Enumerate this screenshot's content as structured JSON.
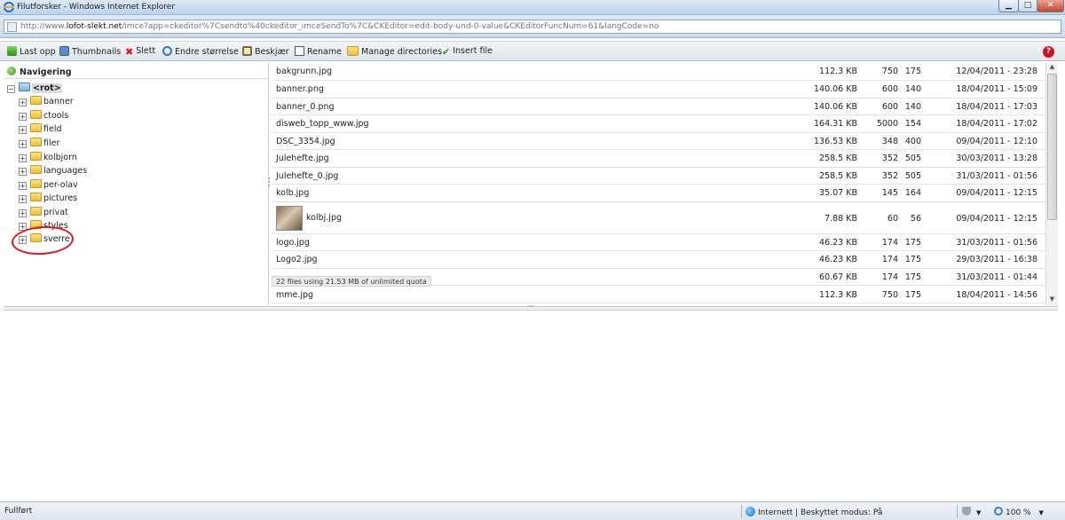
{
  "window": {
    "title": "Filutforsker - Windows Internet Explorer",
    "min_label": "▁",
    "max_label": "□",
    "close_label": "✕",
    "url_prefix": "http://www.",
    "url_host": "lofot-slekt.net",
    "url_rest": "/imce?app=ckeditor%7Csendto%40ckeditor_imceSendTo%7C&CKEditor=edit-body-und-0-value&CKEditorFuncNum=61&langCode=no"
  },
  "toolbar": {
    "upload": "Last opp",
    "thumbnails": "Thumbnails",
    "delete": "Slett",
    "resize": "Endre størrelse",
    "crop": "Beskjær",
    "rename": "Rename",
    "manage": "Manage directories",
    "insert": "Insert file",
    "help": "?"
  },
  "nav": {
    "heading": "Navigering",
    "root": "<rot>",
    "folders": [
      "banner",
      "ctools",
      "field",
      "filer",
      "kolbjorn",
      "languages",
      "per-olav",
      "pictures",
      "privat",
      "styles",
      "sverre"
    ]
  },
  "files": [
    {
      "name": "bakgrunn.jpg",
      "size": "112.3 KB",
      "w": "750",
      "h": "175",
      "date": "12/04/2011 - 23:28"
    },
    {
      "name": "banner.png",
      "size": "140.06 KB",
      "w": "600",
      "h": "140",
      "date": "18/04/2011 - 15:09"
    },
    {
      "name": "banner_0.png",
      "size": "140.06 KB",
      "w": "600",
      "h": "140",
      "date": "18/04/2011 - 17:03"
    },
    {
      "name": "disweb_topp_www.jpg",
      "size": "164.31 KB",
      "w": "5000",
      "h": "154",
      "date": "18/04/2011 - 17:02"
    },
    {
      "name": "DSC_3354.jpg",
      "size": "136.53 KB",
      "w": "348",
      "h": "400",
      "date": "09/04/2011 - 12:10"
    },
    {
      "name": "Julehefte.jpg",
      "size": "258.5 KB",
      "w": "352",
      "h": "505",
      "date": "30/03/2011 - 13:28"
    },
    {
      "name": "Julehefte_0.jpg",
      "size": "258.5 KB",
      "w": "352",
      "h": "505",
      "date": "31/03/2011 - 01:56"
    },
    {
      "name": "kolb.jpg",
      "size": "35.07 KB",
      "w": "145",
      "h": "164",
      "date": "09/04/2011 - 12:15"
    },
    {
      "name": "kolbj.jpg",
      "size": "7.88 KB",
      "w": "60",
      "h": "56",
      "date": "09/04/2011 - 12:15"
    },
    {
      "name": "logo.jpg",
      "size": "46.23 KB",
      "w": "174",
      "h": "175",
      "date": "31/03/2011 - 01:56"
    },
    {
      "name": "Logo2.jpg",
      "size": "46.23 KB",
      "w": "174",
      "h": "175",
      "date": "29/03/2011 - 16:38"
    },
    {
      "name": "",
      "size": "60.67 KB",
      "w": "174",
      "h": "175",
      "date": "31/03/2011 - 01:44"
    },
    {
      "name": "mme.jpg",
      "size": "112.3 KB",
      "w": "750",
      "h": "175",
      "date": "18/04/2011 - 14:56"
    }
  ],
  "quota": "22 files using 21.53 MB of unlimited quota",
  "status": {
    "left": "Fullført",
    "zone": "Internett | Beskyttet modus: På",
    "zoom": "100 %"
  }
}
